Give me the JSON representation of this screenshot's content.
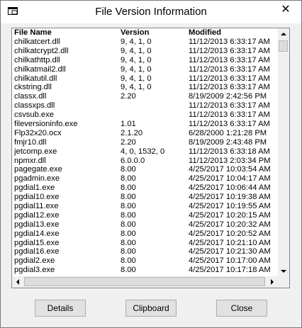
{
  "window": {
    "title": "File Version Information",
    "close_glyph": "✕"
  },
  "columns": {
    "name": "File Name",
    "version": "Version",
    "modified": "Modified"
  },
  "rows": [
    {
      "name": "chilkatcert.dll",
      "version": "9, 4, 1, 0",
      "modified": "11/12/2013 6:33:17 AM"
    },
    {
      "name": "chilkatcrypt2.dll",
      "version": "9, 4, 1, 0",
      "modified": "11/12/2013 6:33:17 AM"
    },
    {
      "name": "chilkathttp.dll",
      "version": "9, 4, 1, 0",
      "modified": "11/12/2013 6:33:17 AM"
    },
    {
      "name": "chilkatmail2.dll",
      "version": "9, 4, 1, 0",
      "modified": "11/12/2013 6:33:17 AM"
    },
    {
      "name": "chilkatutil.dll",
      "version": "9, 4, 1, 0",
      "modified": "11/12/2013 6:33:17 AM"
    },
    {
      "name": "ckstring.dll",
      "version": "9, 4, 1, 0",
      "modified": "11/12/2013 6:33:17 AM"
    },
    {
      "name": "classx.dll",
      "version": "2.20",
      "modified": "8/19/2009 2:42:56 PM"
    },
    {
      "name": "classxps.dll",
      "version": "",
      "modified": "11/12/2013 6:33:17 AM"
    },
    {
      "name": "csvsub.exe",
      "version": "",
      "modified": "11/12/2013 6:33:17 AM"
    },
    {
      "name": "fileversioninfo.exe",
      "version": "1.01",
      "modified": "11/12/2013 6:33:17 AM"
    },
    {
      "name": "Flp32x20.ocx",
      "version": "2.1.20",
      "modified": "6/28/2000 1:21:28 PM"
    },
    {
      "name": "fmjr10.dll",
      "version": "2.20",
      "modified": "8/19/2009 2:43:48 PM"
    },
    {
      "name": "jetcomp.exe",
      "version": "4, 0, 1532, 0",
      "modified": "11/12/2013 6:33:18 AM"
    },
    {
      "name": "npmxr.dll",
      "version": "6.0.0.0",
      "modified": "11/12/2013 2:03:34 PM"
    },
    {
      "name": "pagegate.exe",
      "version": "8.00",
      "modified": "4/25/2017 10:03:54 AM"
    },
    {
      "name": "pgadmin.exe",
      "version": "8.00",
      "modified": "4/25/2017 10:04:17 AM"
    },
    {
      "name": "pgdial1.exe",
      "version": "8.00",
      "modified": "4/25/2017 10:06:44 AM"
    },
    {
      "name": "pgdial10.exe",
      "version": "8.00",
      "modified": "4/25/2017 10:19:38 AM"
    },
    {
      "name": "pgdial11.exe",
      "version": "8.00",
      "modified": "4/25/2017 10:19:55 AM"
    },
    {
      "name": "pgdial12.exe",
      "version": "8.00",
      "modified": "4/25/2017 10:20:15 AM"
    },
    {
      "name": "pgdial13.exe",
      "version": "8.00",
      "modified": "4/25/2017 10:20:32 AM"
    },
    {
      "name": "pgdial14.exe",
      "version": "8.00",
      "modified": "4/25/2017 10:20:52 AM"
    },
    {
      "name": "pgdial15.exe",
      "version": "8.00",
      "modified": "4/25/2017 10:21:10 AM"
    },
    {
      "name": "pgdial16.exe",
      "version": "8.00",
      "modified": "4/25/2017 10:21:30 AM"
    },
    {
      "name": "pgdial2.exe",
      "version": "8.00",
      "modified": "4/25/2017 10:17:00 AM"
    },
    {
      "name": "pgdial3.exe",
      "version": "8.00",
      "modified": "4/25/2017 10:17:18 AM"
    }
  ],
  "buttons": {
    "details": "Details",
    "clipboard": "Clipboard",
    "close": "Close"
  },
  "icons": {
    "app": "window-icon",
    "close": "close-icon"
  }
}
